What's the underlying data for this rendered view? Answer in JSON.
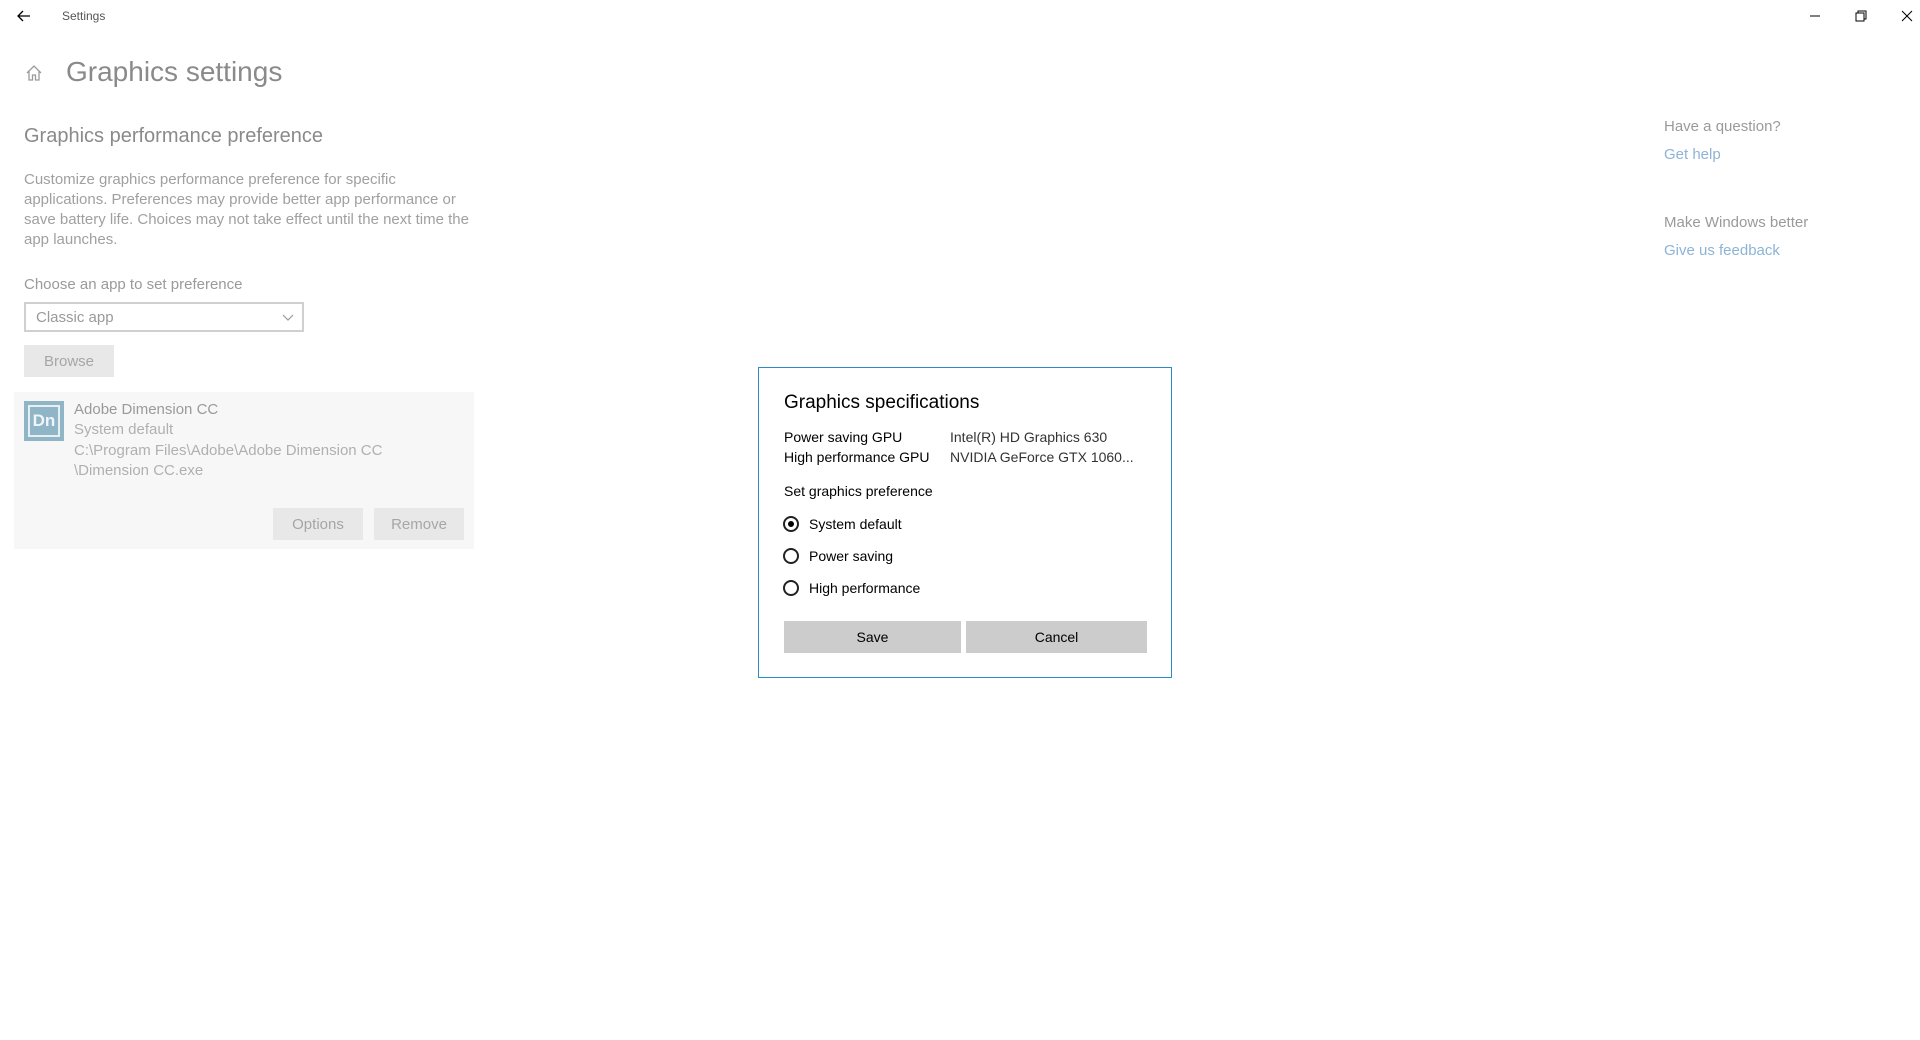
{
  "window": {
    "title": "Settings"
  },
  "page": {
    "title": "Graphics settings",
    "section_title": "Graphics performance preference",
    "description": "Customize graphics performance preference for specific applications. Preferences may provide better app performance or save battery life. Choices may not take effect until the next time the app launches.",
    "choose_label": "Choose an app to set preference",
    "dropdown_value": "Classic app",
    "browse_label": "Browse"
  },
  "app_entry": {
    "icon_text": "Dn",
    "name": "Adobe Dimension CC",
    "preference": "System default",
    "path_line1": "C:\\Program Files\\Adobe\\Adobe Dimension CC",
    "path_line2": "\\Dimension CC.exe",
    "options_label": "Options",
    "remove_label": "Remove"
  },
  "sidebar": {
    "question": "Have a question?",
    "get_help": "Get help",
    "make_better": "Make Windows better",
    "feedback": "Give us feedback"
  },
  "dialog": {
    "title": "Graphics specifications",
    "power_saving_label": "Power saving GPU",
    "power_saving_value": "Intel(R) HD Graphics 630",
    "high_perf_label": "High performance GPU",
    "high_perf_value": "NVIDIA GeForce GTX 1060...",
    "pref_label": "Set graphics preference",
    "options": [
      {
        "label": "System default",
        "checked": true
      },
      {
        "label": "Power saving",
        "checked": false
      },
      {
        "label": "High performance",
        "checked": false
      }
    ],
    "save_label": "Save",
    "cancel_label": "Cancel"
  },
  "colors": {
    "accent_border": "#2b8bc6",
    "link": "#8db3d6",
    "dialog_button": "#cccccc"
  },
  "icons": {
    "back": "back-arrow-icon",
    "home": "home-icon",
    "dropdown": "chevron-down-icon",
    "minimize": "minimize-icon",
    "restore": "restore-icon",
    "close": "close-icon"
  }
}
